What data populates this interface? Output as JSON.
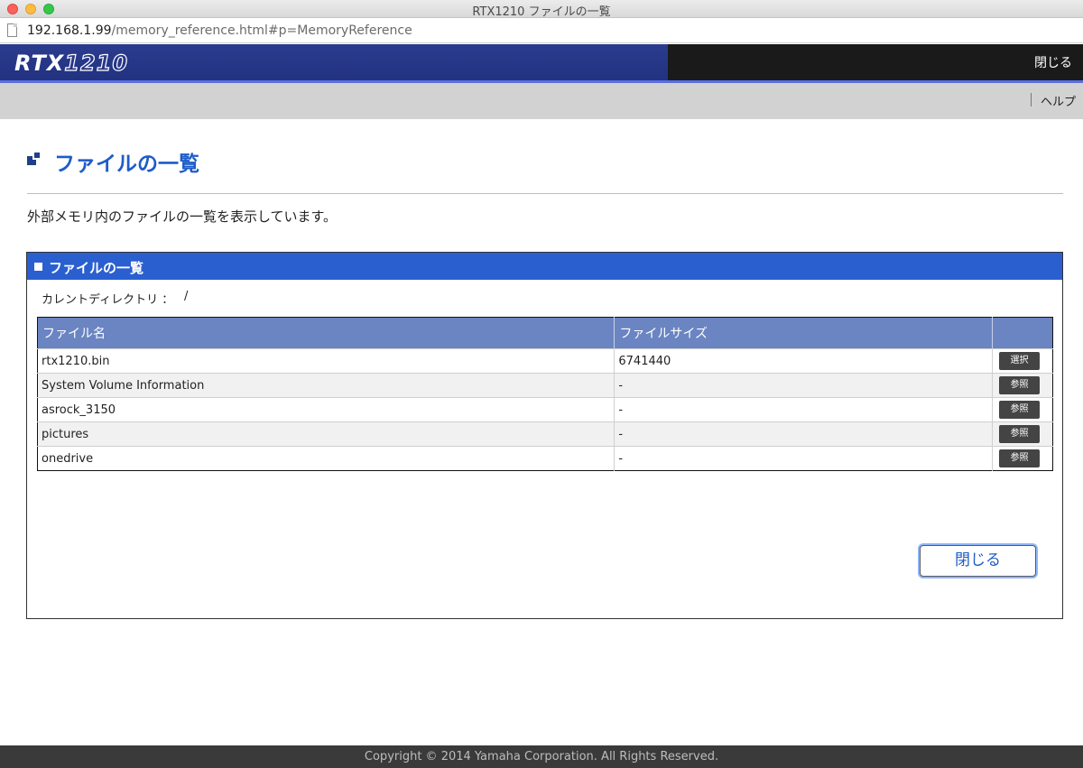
{
  "window": {
    "title": "RTX1210 ファイルの一覧",
    "url_host": "192.168.1.99",
    "url_path": "/memory_reference.html#p=MemoryReference"
  },
  "header": {
    "logo_prefix": "RTX",
    "logo_model": "1210",
    "close_label": "閉じる",
    "help_label": "ヘルプ"
  },
  "page": {
    "title": "ファイルの一覧",
    "description": "外部メモリ内のファイルの一覧を表示しています。"
  },
  "panel": {
    "title": "ファイルの一覧",
    "current_dir_label": "カレントディレクトリ ：",
    "current_dir_value": "/",
    "columns": [
      "ファイル名",
      "ファイルサイズ"
    ],
    "rows": [
      {
        "name": "rtx1210.bin",
        "size": "6741440",
        "action": "選択"
      },
      {
        "name": "System Volume Information",
        "size": "-",
        "action": "参照"
      },
      {
        "name": "asrock_3150",
        "size": "-",
        "action": "参照"
      },
      {
        "name": "pictures",
        "size": "-",
        "action": "参照"
      },
      {
        "name": "onedrive",
        "size": "-",
        "action": "参照"
      }
    ],
    "close_button": "閉じる"
  },
  "footer": {
    "copyright": "Copyright © 2014 Yamaha Corporation. All Rights Reserved."
  },
  "colors": {
    "brand_blue": "#223280",
    "accent_blue": "#2a5fd0",
    "title_blue": "#1e5cc8",
    "table_header": "#6b84c2"
  }
}
